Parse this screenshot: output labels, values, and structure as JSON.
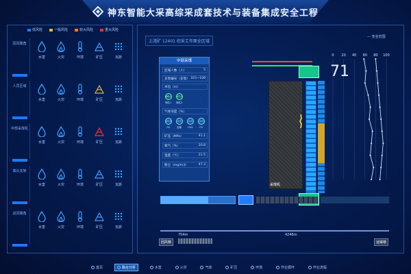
{
  "header": {
    "title": "神东智能大采高综采成套技术与装备集成安全工程",
    "logo_icon": "diamond-logo-icon"
  },
  "legend": [
    {
      "label": "低风险",
      "color": "#1f7dff"
    },
    {
      "label": "一般风险",
      "color": "#e0b43a"
    },
    {
      "label": "较大风险",
      "color": "#ff7a1a"
    },
    {
      "label": "重大风险",
      "color": "#ff2d2d"
    }
  ],
  "rows": [
    {
      "label": "回风隅角",
      "level": "low"
    },
    {
      "label": "人员区域",
      "level": "mixed"
    },
    {
      "label": "中部采煤机",
      "level": "mixed"
    },
    {
      "label": "端头支架",
      "level": "low"
    },
    {
      "label": "进风隅角",
      "level": "low"
    }
  ],
  "icons": [
    {
      "label": "水害",
      "icon": "water-drop-icon"
    },
    {
      "label": "火灾",
      "icon": "fire-icon"
    },
    {
      "label": "环境",
      "icon": "thermometer-icon"
    },
    {
      "label": "矿压",
      "icon": "mountain-icon"
    },
    {
      "label": "瓦斯",
      "icon": "dots-grid-icon"
    }
  ],
  "main": {
    "location": "上湾矿 12401 综采工作面全区域",
    "safe_label": "— 安全范围",
    "big_value": "71",
    "info_card": {
      "title": "中部采煤",
      "people_label": "区域人数（人）",
      "people_value": "5",
      "support_label": "支架编号（支架）",
      "support_value": "021~108",
      "water_label": "水位（m）",
      "water1": "68.1",
      "water2": "67.5",
      "well1": "测孔1",
      "well2": "测孔2",
      "gas_section": "气体浓度（%）",
      "g1": "20.0",
      "g2": "0.0",
      "g3": "0.0",
      "g4": "0.0",
      "g1_label": "O2",
      "g2_label": "瓦斯",
      "g3_label": "CH4",
      "g4_label": "CO",
      "pressure_label": "矿压（MPa）",
      "pressure_value": "41.1",
      "oxygen_label": "氧气（%）",
      "oxygen_value": "20.8",
      "temp_label": "温度（℃）",
      "temp_value": "21.5",
      "dust_label": "粉尘（mg/m3）",
      "dust_value": "47.3"
    },
    "coal_label": "采煤机",
    "ruler": {
      "left": "754m",
      "right": "4246m",
      "end_left": "回风巷",
      "end_right": "运输巷"
    }
  },
  "chart_data": {
    "type": "line",
    "x_ticks": [
      "0",
      "20",
      "40",
      "60",
      "80",
      "100"
    ],
    "xlim": [
      0,
      100
    ],
    "series": [
      {
        "values": [
          58,
          62,
          60,
          66,
          70,
          68,
          74,
          72,
          70,
          76,
          72
        ]
      },
      {
        "values": [
          80,
          82,
          84,
          86,
          88,
          90,
          92,
          94,
          92,
          90,
          88
        ]
      }
    ]
  },
  "nav": [
    {
      "label": "首页",
      "active": false
    },
    {
      "label": "融合分析",
      "active": true
    },
    {
      "label": "水害",
      "active": false
    },
    {
      "label": "火灾",
      "active": false
    },
    {
      "label": "气体",
      "active": false
    },
    {
      "label": "矿压",
      "active": false
    },
    {
      "label": "环境",
      "active": false
    },
    {
      "label": "作业循环",
      "active": false
    },
    {
      "label": "作业流程",
      "active": false
    }
  ]
}
